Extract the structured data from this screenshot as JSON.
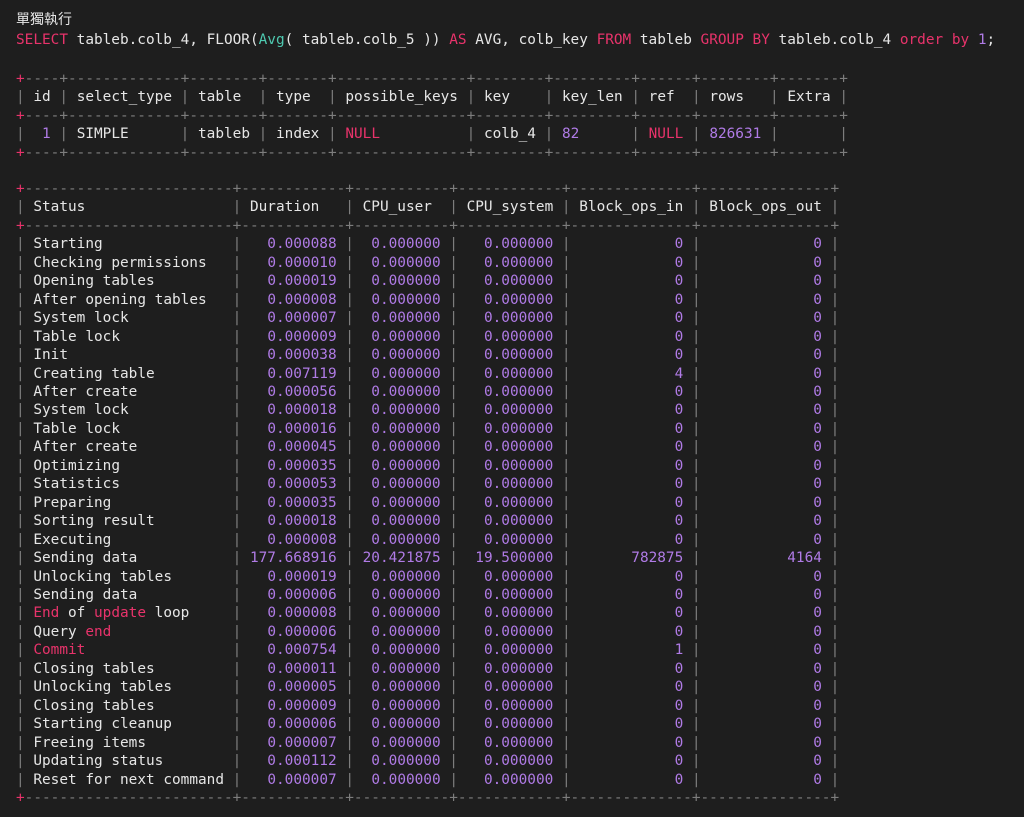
{
  "heading": "單獨執行",
  "sql": {
    "select_kw": "SELECT",
    "col1": "tableb.colb_4",
    "sep1": ", ",
    "floor": "FLOOR",
    "avg": "Avg",
    "col2": "tableb.colb_5",
    "as_kw": "AS",
    "alias": "AVG",
    "sep2": ", ",
    "col3": "colb_key",
    "from_kw": "FROM",
    "table": "tableb",
    "group_kw": "GROUP BY",
    "col4": "tableb.colb_4",
    "order_kw": "order by",
    "order_val": "1",
    "end": ";"
  },
  "colors": {
    "keyword": "#e8336b",
    "function": "#4ec9b0",
    "number": "#b07be6",
    "border": "#7d7d7d",
    "text": "#e6e6e6",
    "background": "#1e1e1e"
  },
  "explain": {
    "headers": [
      "id",
      "select_type",
      "table",
      "type",
      "possible_keys",
      "key",
      "key_len",
      "ref",
      "rows",
      "Extra"
    ],
    "row": {
      "id": "1",
      "select_type": "SIMPLE",
      "table": "tableb",
      "type": "index",
      "possible_keys": "NULL",
      "key": "colb_4",
      "key_len": "82",
      "ref": "NULL",
      "rows": "826631",
      "Extra": ""
    }
  },
  "profile": {
    "headers": [
      "Status",
      "Duration",
      "CPU_user",
      "CPU_system",
      "Block_ops_in",
      "Block_ops_out"
    ],
    "rows": [
      [
        "Starting",
        "0.000088",
        "0.000000",
        "0.000000",
        "0",
        "0"
      ],
      [
        "Checking permissions",
        "0.000010",
        "0.000000",
        "0.000000",
        "0",
        "0"
      ],
      [
        "Opening tables",
        "0.000019",
        "0.000000",
        "0.000000",
        "0",
        "0"
      ],
      [
        "After opening tables",
        "0.000008",
        "0.000000",
        "0.000000",
        "0",
        "0"
      ],
      [
        "System lock",
        "0.000007",
        "0.000000",
        "0.000000",
        "0",
        "0"
      ],
      [
        "Table lock",
        "0.000009",
        "0.000000",
        "0.000000",
        "0",
        "0"
      ],
      [
        "Init",
        "0.000038",
        "0.000000",
        "0.000000",
        "0",
        "0"
      ],
      [
        "Creating table",
        "0.007119",
        "0.000000",
        "0.000000",
        "4",
        "0"
      ],
      [
        "After create",
        "0.000056",
        "0.000000",
        "0.000000",
        "0",
        "0"
      ],
      [
        "System lock",
        "0.000018",
        "0.000000",
        "0.000000",
        "0",
        "0"
      ],
      [
        "Table lock",
        "0.000016",
        "0.000000",
        "0.000000",
        "0",
        "0"
      ],
      [
        "After create",
        "0.000045",
        "0.000000",
        "0.000000",
        "0",
        "0"
      ],
      [
        "Optimizing",
        "0.000035",
        "0.000000",
        "0.000000",
        "0",
        "0"
      ],
      [
        "Statistics",
        "0.000053",
        "0.000000",
        "0.000000",
        "0",
        "0"
      ],
      [
        "Preparing",
        "0.000035",
        "0.000000",
        "0.000000",
        "0",
        "0"
      ],
      [
        "Sorting result",
        "0.000018",
        "0.000000",
        "0.000000",
        "0",
        "0"
      ],
      [
        "Executing",
        "0.000008",
        "0.000000",
        "0.000000",
        "0",
        "0"
      ],
      [
        "Sending data",
        "177.668916",
        "20.421875",
        "19.500000",
        "782875",
        "4164"
      ],
      [
        "Unlocking tables",
        "0.000019",
        "0.000000",
        "0.000000",
        "0",
        "0"
      ],
      [
        "Sending data",
        "0.000006",
        "0.000000",
        "0.000000",
        "0",
        "0"
      ],
      [
        "End of update loop",
        "0.000008",
        "0.000000",
        "0.000000",
        "0",
        "0"
      ],
      [
        "Query end",
        "0.000006",
        "0.000000",
        "0.000000",
        "0",
        "0"
      ],
      [
        "Commit",
        "0.000754",
        "0.000000",
        "0.000000",
        "1",
        "0"
      ],
      [
        "Closing tables",
        "0.000011",
        "0.000000",
        "0.000000",
        "0",
        "0"
      ],
      [
        "Unlocking tables",
        "0.000005",
        "0.000000",
        "0.000000",
        "0",
        "0"
      ],
      [
        "Closing tables",
        "0.000009",
        "0.000000",
        "0.000000",
        "0",
        "0"
      ],
      [
        "Starting cleanup",
        "0.000006",
        "0.000000",
        "0.000000",
        "0",
        "0"
      ],
      [
        "Freeing items",
        "0.000007",
        "0.000000",
        "0.000000",
        "0",
        "0"
      ],
      [
        "Updating status",
        "0.000112",
        "0.000000",
        "0.000000",
        "0",
        "0"
      ],
      [
        "Reset for next command",
        "0.000007",
        "0.000000",
        "0.000000",
        "0",
        "0"
      ]
    ]
  }
}
